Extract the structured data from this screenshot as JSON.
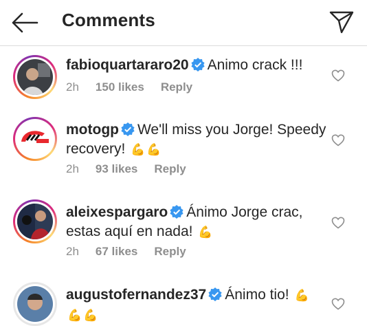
{
  "header": {
    "title": "Comments",
    "back_icon": "back-arrow-icon",
    "send_icon": "direct-send-icon"
  },
  "comments": [
    {
      "username": "fabioquartararo20",
      "text": "Animo crack !!!",
      "emojis": [],
      "time": "2h",
      "likes": "150 likes",
      "reply": "Reply"
    },
    {
      "username": "motogp",
      "text": "We'll miss you Jorge! Speedy recovery!",
      "emojis": [
        "💪",
        "💪"
      ],
      "time": "2h",
      "likes": "93 likes",
      "reply": "Reply"
    },
    {
      "username": "aleixespargaro",
      "text": "Ánimo Jorge crac, estas aquí en nada!",
      "emojis": [
        "💪"
      ],
      "time": "2h",
      "likes": "67 likes",
      "reply": "Reply"
    },
    {
      "username": "augustofernandez37",
      "text": "Ánimo tio!",
      "emojis": [
        "💪",
        "💪",
        "💪"
      ],
      "time": "",
      "likes": "",
      "reply": ""
    }
  ],
  "colors": {
    "verified": "#3897f0",
    "muted": "#8e8e8e",
    "text": "#262626"
  }
}
